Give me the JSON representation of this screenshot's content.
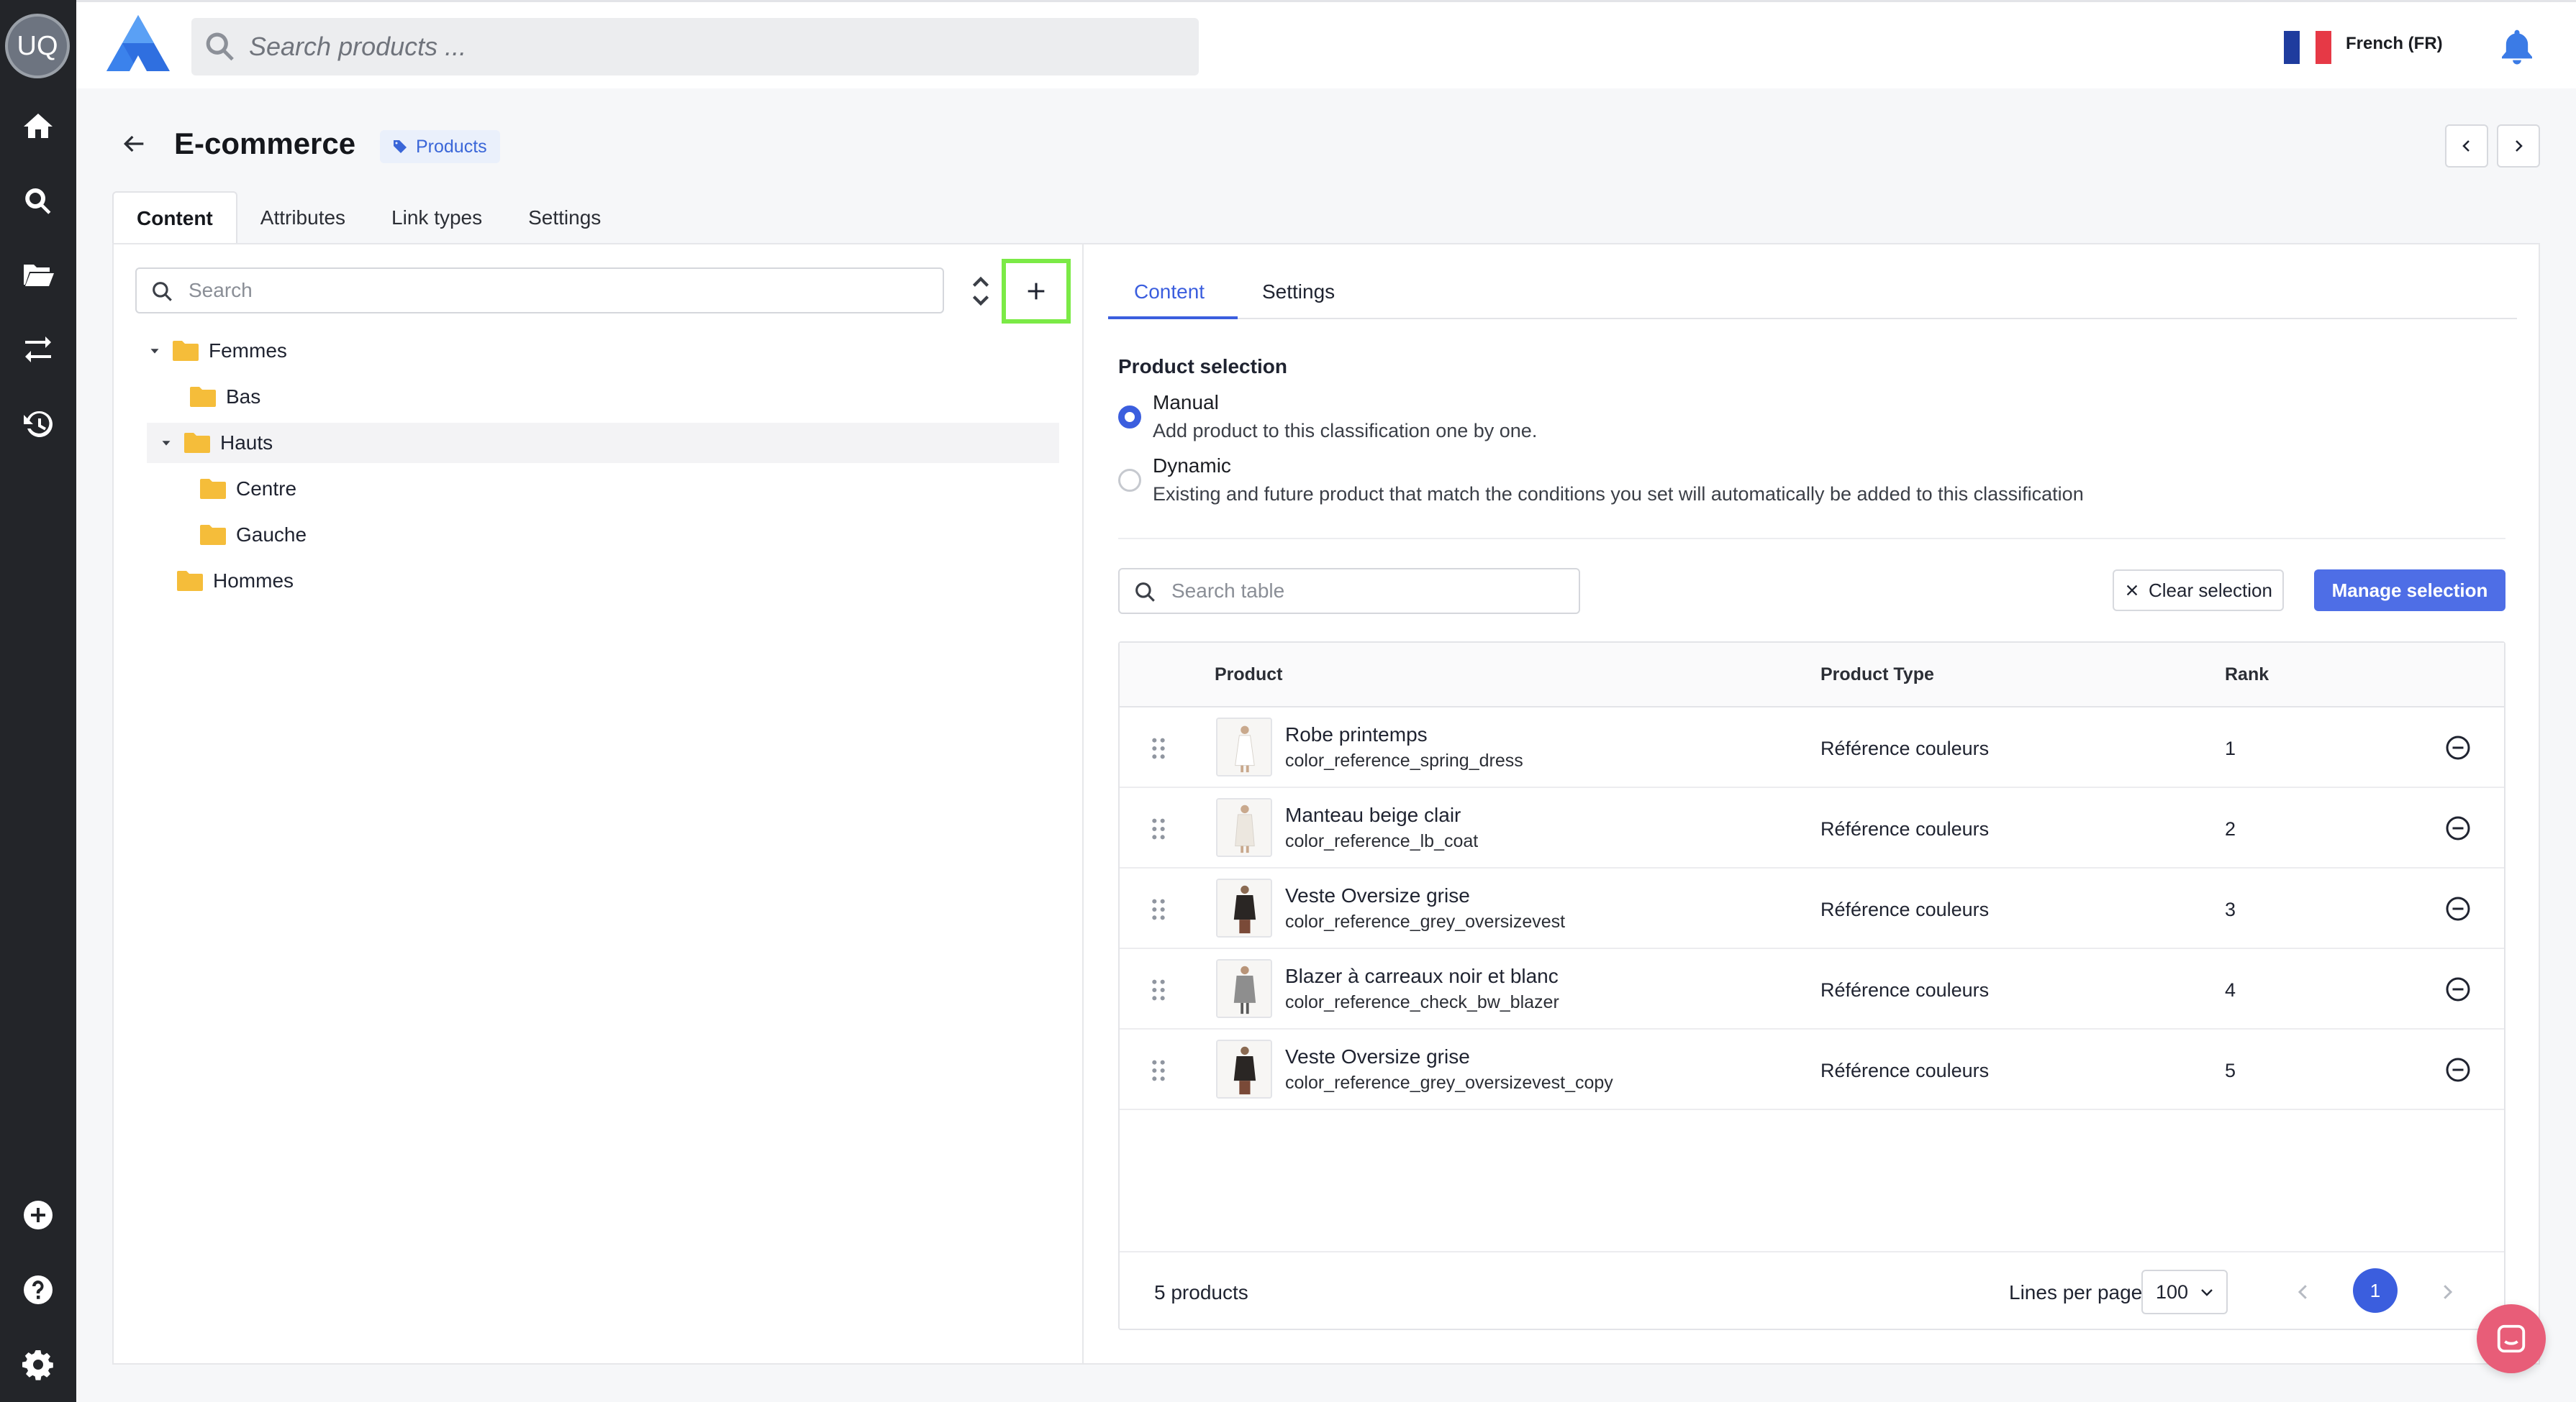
{
  "rail": {
    "avatar_initials": "UQ",
    "items": [
      "home-icon",
      "search-icon",
      "folder-open-icon",
      "transfer-icon",
      "history-icon",
      "add-circle-icon",
      "help-icon",
      "gear-icon"
    ]
  },
  "topbar": {
    "search_placeholder": "Search products ...",
    "language": "French (FR)",
    "flag_colors": [
      "#1f3c9e",
      "#ffffff",
      "#e63946"
    ]
  },
  "header": {
    "title": "E-commerce",
    "tag": "Products"
  },
  "main_tabs": [
    "Content",
    "Attributes",
    "Link types",
    "Settings"
  ],
  "tree": {
    "search_placeholder": "Search",
    "nodes": [
      {
        "label": "Femmes"
      },
      {
        "label": "Bas"
      },
      {
        "label": "Hauts"
      },
      {
        "label": "Centre"
      },
      {
        "label": "Gauche"
      },
      {
        "label": "Hommes"
      }
    ]
  },
  "right": {
    "tabs": [
      "Content",
      "Settings"
    ],
    "selection_title": "Product selection",
    "manual_label": "Manual",
    "manual_desc": "Add product to this classification one by one.",
    "dynamic_label": "Dynamic",
    "dynamic_desc": "Existing and future product that match the conditions you set will automatically be added to this classification",
    "table_search_placeholder": "Search table",
    "clear_label": "Clear selection",
    "manage_label": "Manage selection",
    "columns": [
      "Product",
      "Product Type",
      "Rank"
    ],
    "rows": [
      {
        "name": "Robe printemps",
        "code": "color_reference_spring_dress",
        "type": "Référence couleurs",
        "rank": "1"
      },
      {
        "name": "Manteau beige clair",
        "code": "color_reference_lb_coat",
        "type": "Référence couleurs",
        "rank": "2"
      },
      {
        "name": "Veste Oversize grise",
        "code": "color_reference_grey_oversizevest",
        "type": "Référence couleurs",
        "rank": "3"
      },
      {
        "name": "Blazer à carreaux noir et blanc",
        "code": "color_reference_check_bw_blazer",
        "type": "Référence couleurs",
        "rank": "4"
      },
      {
        "name": "Veste Oversize grise",
        "code": "color_reference_grey_oversizevest_copy",
        "type": "Référence couleurs",
        "rank": "5"
      }
    ],
    "count_label": "5 products",
    "lines_per_page_label": "Lines per page",
    "lines_per_page_value": "100",
    "current_page": "1"
  },
  "colors": {
    "accent": "#3b5ede",
    "highlight_border": "#7bea46",
    "folder": "#f5bd3a",
    "chat": "#e85d78"
  }
}
